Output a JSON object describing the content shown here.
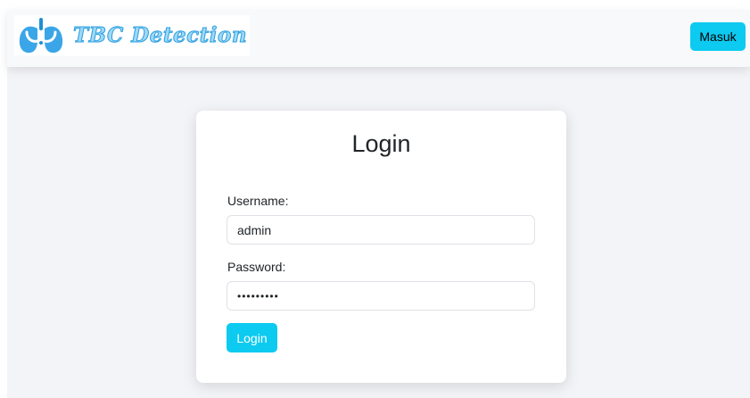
{
  "navbar": {
    "brand_text": "TBC Detection",
    "logo_icon": "lungs-stethoscope-icon",
    "masuk_label": "Masuk"
  },
  "login_card": {
    "title": "Login",
    "username_label": "Username:",
    "username_value": "admin",
    "password_label": "Password:",
    "password_value": "•••••••••",
    "submit_label": "Login"
  },
  "colors": {
    "accent": "#0dcaf0",
    "brand_fill": "#9fd8f5",
    "brand_stroke": "#2b9fe0"
  }
}
